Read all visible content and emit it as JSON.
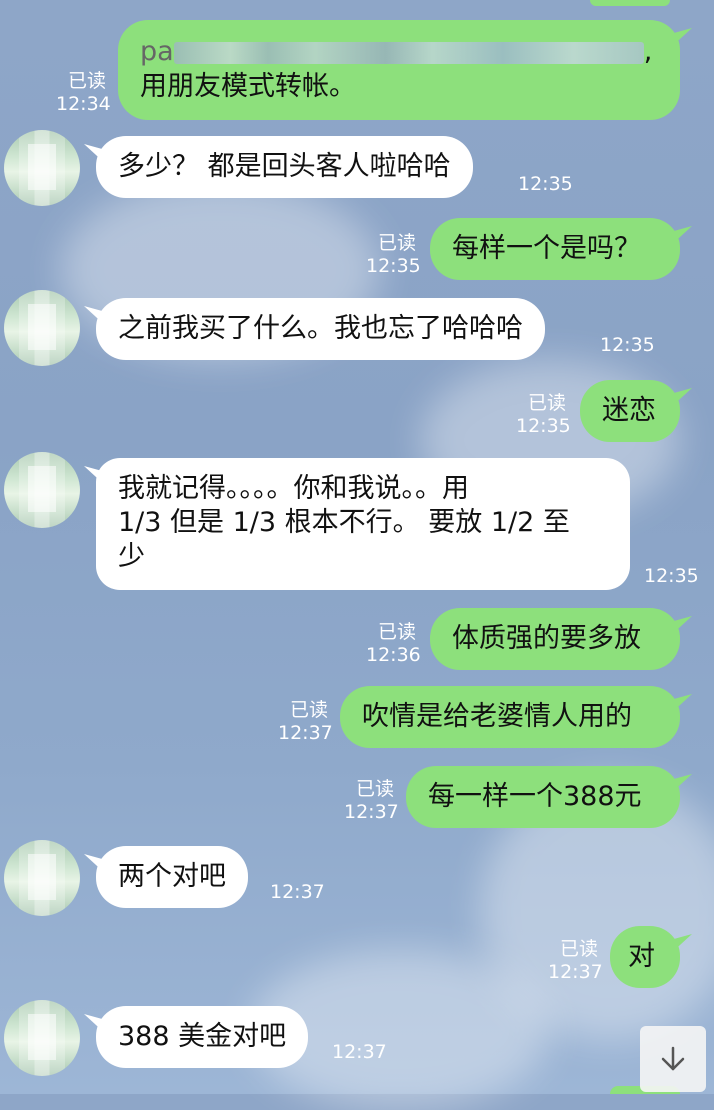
{
  "messages": [
    {
      "side": "out",
      "lines": [
        "pa",
        "用朋友模式转帐。"
      ],
      "read": "已读",
      "time": "12:34"
    },
    {
      "side": "in",
      "text": "多少？ 都是回头客人啦哈哈",
      "time": "12:35"
    },
    {
      "side": "out",
      "text": "每样一个是吗？",
      "read": "已读",
      "time": "12:35"
    },
    {
      "side": "in",
      "text": "之前我买了什么。我也忘了哈哈哈",
      "time": "12:35"
    },
    {
      "side": "out",
      "text": "迷恋",
      "read": "已读",
      "time": "12:35"
    },
    {
      "side": "in",
      "lines": [
        "我就记得。。。。你和我说。。用",
        "1/3 但是 1/3 根本不行。 要放 1/2 至",
        "少"
      ],
      "time": "12:35"
    },
    {
      "side": "out",
      "text": "体质强的要多放",
      "read": "已读",
      "time": "12:36"
    },
    {
      "side": "out",
      "text": "吹情是给老婆情人用的",
      "read": "已读",
      "time": "12:37"
    },
    {
      "side": "out",
      "text": "每一样一个388元",
      "read": "已读",
      "time": "12:37"
    },
    {
      "side": "in",
      "text": "两个对吧",
      "time": "12:37"
    },
    {
      "side": "out",
      "text": "对",
      "read": "已读",
      "time": "12:37"
    },
    {
      "side": "in",
      "text": "388 美金对吧",
      "time": "12:37"
    }
  ],
  "controls": {
    "scroll_icon": "arrow-down-icon"
  },
  "colors": {
    "outgoing": "#8de07c",
    "incoming": "#ffffff",
    "background": "#8ea6c8"
  }
}
